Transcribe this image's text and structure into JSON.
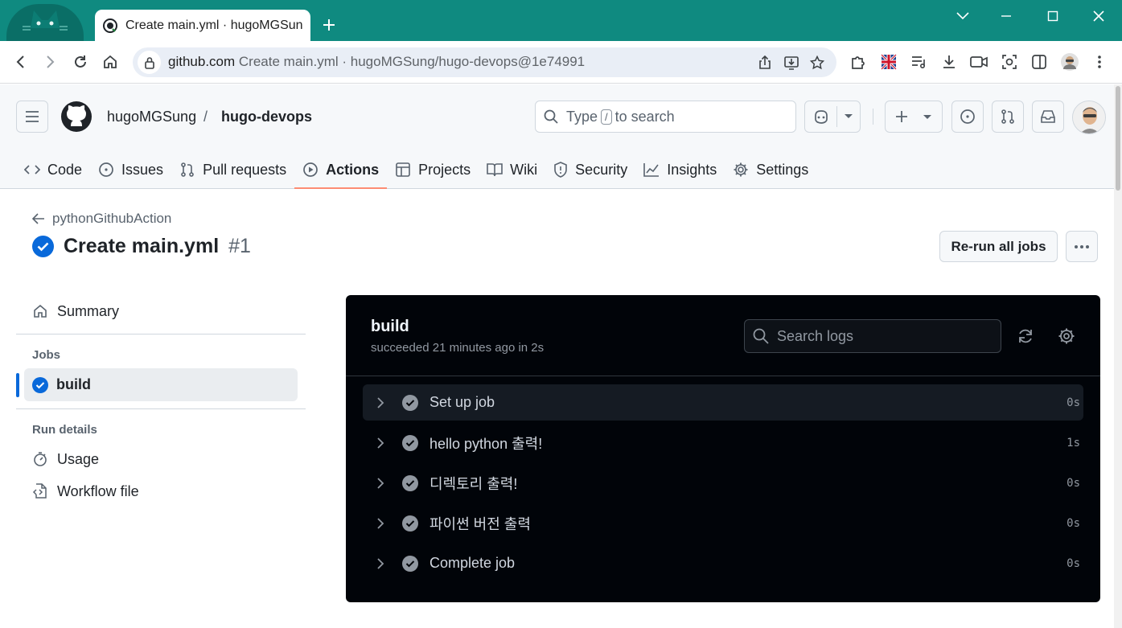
{
  "browser": {
    "tab_title": "Create main.yml · hugoMGSung/hugo-devops@1e74991",
    "url_host": "github.com",
    "url_rest": "Create main.yml · hugoMGSung/hugo-devops@1e74991",
    "tabstrip_color": "#0f8a80"
  },
  "header": {
    "owner": "hugoMGSung",
    "separator": "/",
    "repo": "hugo-devops",
    "search_prefix": "Type",
    "search_key": "/",
    "search_suffix": "to search"
  },
  "repo_nav": [
    {
      "label": "Code",
      "icon": "code-icon"
    },
    {
      "label": "Issues",
      "icon": "issue-icon"
    },
    {
      "label": "Pull requests",
      "icon": "pull-request-icon"
    },
    {
      "label": "Actions",
      "icon": "play-icon",
      "active": true
    },
    {
      "label": "Projects",
      "icon": "table-icon"
    },
    {
      "label": "Wiki",
      "icon": "book-icon"
    },
    {
      "label": "Security",
      "icon": "shield-icon"
    },
    {
      "label": "Insights",
      "icon": "graph-icon"
    },
    {
      "label": "Settings",
      "icon": "gear-icon"
    }
  ],
  "run": {
    "back_label": "pythonGithubAction",
    "title": "Create main.yml",
    "number": "#1",
    "rerun_label": "Re-run all jobs",
    "status": "success"
  },
  "sidebar": {
    "summary": "Summary",
    "jobs_heading": "Jobs",
    "job_label": "build",
    "run_details_heading": "Run details",
    "usage": "Usage",
    "workflow_file": "Workflow file"
  },
  "log": {
    "job_name": "build",
    "meta": "succeeded 21 minutes ago in 2s",
    "search_placeholder": "Search logs",
    "steps": [
      {
        "name": "Set up job",
        "duration": "0s"
      },
      {
        "name": "hello python 출력!",
        "duration": "1s"
      },
      {
        "name": "디렉토리 출력!",
        "duration": "0s"
      },
      {
        "name": "파이썬 버전 출력",
        "duration": "0s"
      },
      {
        "name": "Complete job",
        "duration": "0s"
      }
    ]
  },
  "colors": {
    "accent_blue": "#0969da",
    "active_underline": "#fd8c73",
    "log_bg": "#010409"
  }
}
